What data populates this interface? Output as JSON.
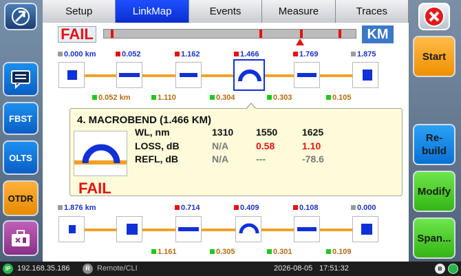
{
  "tabs": [
    "Setup",
    "LinkMap",
    "Events",
    "Measure",
    "Traces"
  ],
  "left_buttons": [
    "FBST",
    "OLTS",
    "OTDR"
  ],
  "right_buttons": {
    "start": "Start",
    "rebuild": "Re-\nbuild",
    "modify": "Modify",
    "span": "Span..."
  },
  "verdict": "FAIL",
  "unit": "KM",
  "row1": {
    "positions": [
      "0.000 km",
      "0.052",
      "1.162",
      "1.466",
      "1.769",
      "1.875"
    ],
    "spans": [
      "0.052 km",
      "1.110",
      "0.304",
      "0.303",
      "0.105"
    ]
  },
  "row2": {
    "positions": [
      "1.876 km",
      "0.714",
      "0.409",
      "0.108",
      "0.000"
    ],
    "spans": [
      "1.161",
      "0.305",
      "0.301",
      "0.109"
    ]
  },
  "detail": {
    "title": "4. MACROBEND (1.466 KM)",
    "headers": [
      "WL, nm",
      "1310",
      "1550",
      "1625"
    ],
    "loss": [
      "LOSS, dB",
      "N/A",
      "0.58",
      "1.10"
    ],
    "refl": [
      "REFL, dB",
      "N/A",
      "---",
      "-78.6"
    ],
    "verdict": "FAIL"
  },
  "status": {
    "ip": "192.168.35.186",
    "remote": "Remote/CLI",
    "date": "2026-08-05",
    "time": "17:51:32"
  },
  "colors": {
    "fail": "#e81010",
    "accent": "#1030d8",
    "fiber": "#f3a126",
    "pass": "#1ec81e"
  }
}
